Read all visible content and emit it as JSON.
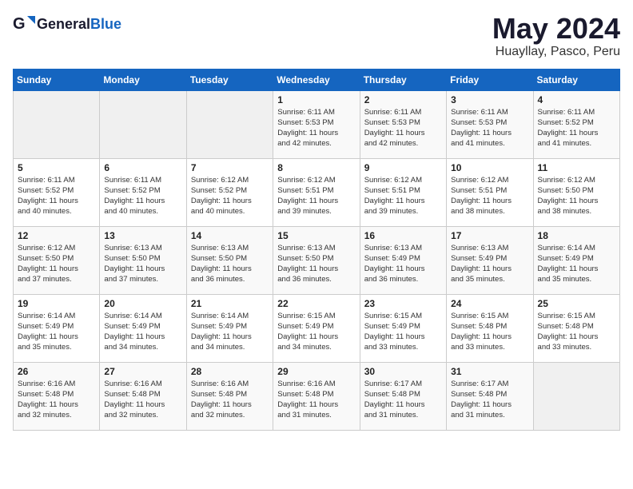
{
  "header": {
    "logo_general": "General",
    "logo_blue": "Blue",
    "month_year": "May 2024",
    "location": "Huayllay, Pasco, Peru"
  },
  "days_of_week": [
    "Sunday",
    "Monday",
    "Tuesday",
    "Wednesday",
    "Thursday",
    "Friday",
    "Saturday"
  ],
  "weeks": [
    [
      {
        "day": "",
        "empty": true
      },
      {
        "day": "",
        "empty": true
      },
      {
        "day": "",
        "empty": true
      },
      {
        "day": "1",
        "sunrise": "6:11 AM",
        "sunset": "5:53 PM",
        "daylight": "11 hours and 42 minutes."
      },
      {
        "day": "2",
        "sunrise": "6:11 AM",
        "sunset": "5:53 PM",
        "daylight": "11 hours and 42 minutes."
      },
      {
        "day": "3",
        "sunrise": "6:11 AM",
        "sunset": "5:53 PM",
        "daylight": "11 hours and 41 minutes."
      },
      {
        "day": "4",
        "sunrise": "6:11 AM",
        "sunset": "5:52 PM",
        "daylight": "11 hours and 41 minutes."
      }
    ],
    [
      {
        "day": "5",
        "sunrise": "6:11 AM",
        "sunset": "5:52 PM",
        "daylight": "11 hours and 40 minutes."
      },
      {
        "day": "6",
        "sunrise": "6:11 AM",
        "sunset": "5:52 PM",
        "daylight": "11 hours and 40 minutes."
      },
      {
        "day": "7",
        "sunrise": "6:12 AM",
        "sunset": "5:52 PM",
        "daylight": "11 hours and 40 minutes."
      },
      {
        "day": "8",
        "sunrise": "6:12 AM",
        "sunset": "5:51 PM",
        "daylight": "11 hours and 39 minutes."
      },
      {
        "day": "9",
        "sunrise": "6:12 AM",
        "sunset": "5:51 PM",
        "daylight": "11 hours and 39 minutes."
      },
      {
        "day": "10",
        "sunrise": "6:12 AM",
        "sunset": "5:51 PM",
        "daylight": "11 hours and 38 minutes."
      },
      {
        "day": "11",
        "sunrise": "6:12 AM",
        "sunset": "5:50 PM",
        "daylight": "11 hours and 38 minutes."
      }
    ],
    [
      {
        "day": "12",
        "sunrise": "6:12 AM",
        "sunset": "5:50 PM",
        "daylight": "11 hours and 37 minutes."
      },
      {
        "day": "13",
        "sunrise": "6:13 AM",
        "sunset": "5:50 PM",
        "daylight": "11 hours and 37 minutes."
      },
      {
        "day": "14",
        "sunrise": "6:13 AM",
        "sunset": "5:50 PM",
        "daylight": "11 hours and 36 minutes."
      },
      {
        "day": "15",
        "sunrise": "6:13 AM",
        "sunset": "5:50 PM",
        "daylight": "11 hours and 36 minutes."
      },
      {
        "day": "16",
        "sunrise": "6:13 AM",
        "sunset": "5:49 PM",
        "daylight": "11 hours and 36 minutes."
      },
      {
        "day": "17",
        "sunrise": "6:13 AM",
        "sunset": "5:49 PM",
        "daylight": "11 hours and 35 minutes."
      },
      {
        "day": "18",
        "sunrise": "6:14 AM",
        "sunset": "5:49 PM",
        "daylight": "11 hours and 35 minutes."
      }
    ],
    [
      {
        "day": "19",
        "sunrise": "6:14 AM",
        "sunset": "5:49 PM",
        "daylight": "11 hours and 35 minutes."
      },
      {
        "day": "20",
        "sunrise": "6:14 AM",
        "sunset": "5:49 PM",
        "daylight": "11 hours and 34 minutes."
      },
      {
        "day": "21",
        "sunrise": "6:14 AM",
        "sunset": "5:49 PM",
        "daylight": "11 hours and 34 minutes."
      },
      {
        "day": "22",
        "sunrise": "6:15 AM",
        "sunset": "5:49 PM",
        "daylight": "11 hours and 34 minutes."
      },
      {
        "day": "23",
        "sunrise": "6:15 AM",
        "sunset": "5:49 PM",
        "daylight": "11 hours and 33 minutes."
      },
      {
        "day": "24",
        "sunrise": "6:15 AM",
        "sunset": "5:48 PM",
        "daylight": "11 hours and 33 minutes."
      },
      {
        "day": "25",
        "sunrise": "6:15 AM",
        "sunset": "5:48 PM",
        "daylight": "11 hours and 33 minutes."
      }
    ],
    [
      {
        "day": "26",
        "sunrise": "6:16 AM",
        "sunset": "5:48 PM",
        "daylight": "11 hours and 32 minutes."
      },
      {
        "day": "27",
        "sunrise": "6:16 AM",
        "sunset": "5:48 PM",
        "daylight": "11 hours and 32 minutes."
      },
      {
        "day": "28",
        "sunrise": "6:16 AM",
        "sunset": "5:48 PM",
        "daylight": "11 hours and 32 minutes."
      },
      {
        "day": "29",
        "sunrise": "6:16 AM",
        "sunset": "5:48 PM",
        "daylight": "11 hours and 31 minutes."
      },
      {
        "day": "30",
        "sunrise": "6:17 AM",
        "sunset": "5:48 PM",
        "daylight": "11 hours and 31 minutes."
      },
      {
        "day": "31",
        "sunrise": "6:17 AM",
        "sunset": "5:48 PM",
        "daylight": "11 hours and 31 minutes."
      },
      {
        "day": "",
        "empty": true
      }
    ]
  ]
}
